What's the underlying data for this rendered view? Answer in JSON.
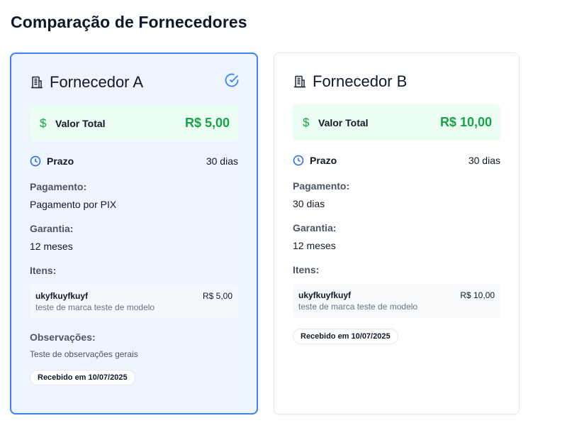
{
  "page": {
    "title": "Comparação de Fornecedores"
  },
  "colors": {
    "accent": "#3b82f6",
    "positive": "#16a34a"
  },
  "suppliers": [
    {
      "name": "Fornecedor A",
      "selected": true,
      "total_label": "Valor Total",
      "total_value": "R$ 5,00",
      "prazo_label": "Prazo",
      "prazo_value": "30 dias",
      "payment_label": "Pagamento:",
      "payment_value": "Pagamento por PIX",
      "warranty_label": "Garantia:",
      "warranty_value": "12 meses",
      "items_label": "Itens:",
      "items": [
        {
          "name": "ukyfkuyfkuyf",
          "desc": "teste de marca teste de modelo",
          "price": "R$ 5,00"
        }
      ],
      "notes_label": "Observações:",
      "notes_value": "Teste de observações gerais",
      "received": "Recebido em 10/07/2025"
    },
    {
      "name": "Fornecedor B",
      "selected": false,
      "total_label": "Valor Total",
      "total_value": "R$ 10,00",
      "prazo_label": "Prazo",
      "prazo_value": "30 dias",
      "payment_label": "Pagamento:",
      "payment_value": "30 dias",
      "warranty_label": "Garantia:",
      "warranty_value": "12 meses",
      "items_label": "Itens:",
      "items": [
        {
          "name": "ukyfkuyfkuyf",
          "desc": "teste de marca teste de modelo",
          "price": "R$ 10,00"
        }
      ],
      "received": "Recebido em 10/07/2025"
    }
  ],
  "icons": [
    "building-icon",
    "check-circle-icon",
    "dollar-icon",
    "clock-icon"
  ]
}
